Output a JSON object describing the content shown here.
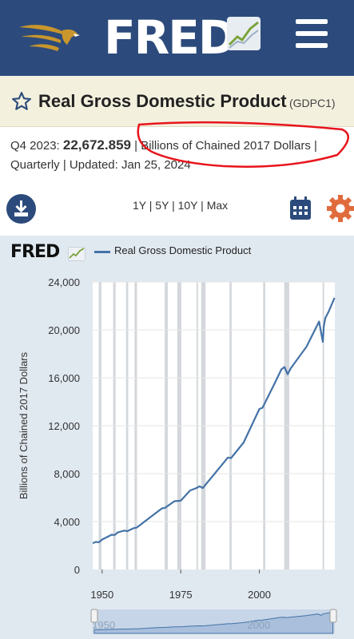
{
  "header": {
    "logo_text": "FRED",
    "brand_color": "#2c4b7c"
  },
  "series": {
    "title": "Real Gross Domestic Product",
    "id": "(GDPC1)",
    "period": "Q4 2023:",
    "value": "22,672.859",
    "units": "| Billions of Chained 2017 Dollars |",
    "freq_updated": "Quarterly | Updated: Jan 25, 2024"
  },
  "toolbar": {
    "range": [
      "1Y",
      "5Y",
      "10Y",
      "Max"
    ],
    "separator": "|"
  },
  "chart_badge_text": "FRED",
  "annotation_color": "#e8141b",
  "chart_data": {
    "type": "line",
    "title": "",
    "legend": [
      "Real Gross Domestic Product"
    ],
    "ylabel": "Billions of Chained 2017 Dollars",
    "xlabel": "",
    "ylim": [
      0,
      24000
    ],
    "xlim": [
      1947,
      2024
    ],
    "y_ticks": [
      "0",
      "4,000",
      "8,000",
      "12,000",
      "16,000",
      "20,000",
      "24,000"
    ],
    "x_ticks": [
      "1950",
      "1975",
      "2000"
    ],
    "line_color": "#4472a7",
    "recessions": [
      [
        1948.9,
        1949.8
      ],
      [
        1953.5,
        1954.3
      ],
      [
        1957.6,
        1958.3
      ],
      [
        1960.3,
        1961.1
      ],
      [
        1969.9,
        1970.9
      ],
      [
        1973.9,
        1975.2
      ],
      [
        1980.0,
        1980.5
      ],
      [
        1981.5,
        1982.9
      ],
      [
        1990.5,
        1991.2
      ],
      [
        2001.2,
        2001.9
      ],
      [
        2007.9,
        2009.5
      ],
      [
        2020.1,
        2020.4
      ]
    ],
    "series": [
      {
        "name": "Real Gross Domestic Product",
        "x": [
          1947,
          1948,
          1949,
          1950,
          1953,
          1954,
          1955,
          1957,
          1958,
          1960,
          1961,
          1965,
          1969,
          1970,
          1973,
          1975,
          1978,
          1980,
          1981,
          1982,
          1985,
          1990,
          1991,
          1995,
          2000,
          2001,
          2005,
          2007,
          2008,
          2009,
          2010,
          2015,
          2019,
          2020.2,
          2020.5,
          2021,
          2022,
          2023.9
        ],
        "y": [
          2200,
          2300,
          2280,
          2500,
          2900,
          2880,
          3100,
          3250,
          3200,
          3450,
          3500,
          4300,
          5100,
          5150,
          5700,
          5750,
          6600,
          6800,
          6950,
          6800,
          7750,
          9350,
          9300,
          10600,
          13400,
          13500,
          15600,
          16700,
          16900,
          16300,
          16800,
          18600,
          20700,
          19000,
          20300,
          21000,
          21500,
          22672
        ]
      }
    ]
  },
  "navigator": {
    "labels": [
      "1950",
      "2000"
    ]
  }
}
